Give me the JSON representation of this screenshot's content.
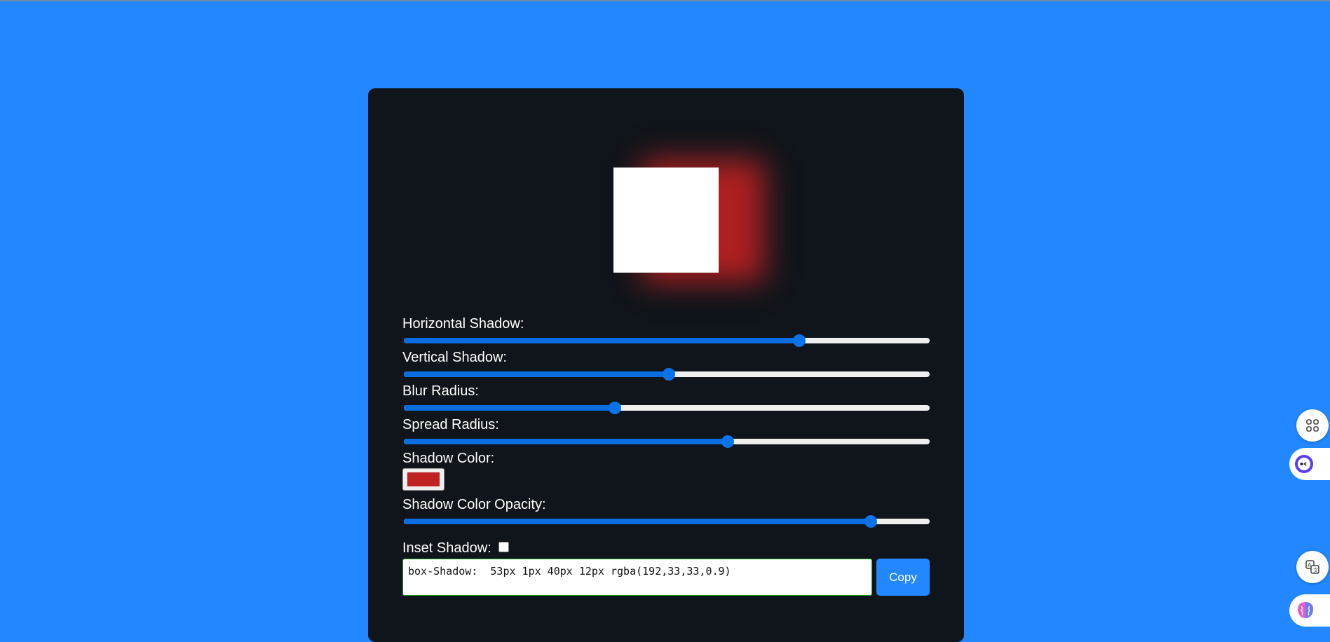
{
  "preview": {
    "box_color": "#ffffff",
    "shadow_color": "#c02121"
  },
  "controls": {
    "horizontal": {
      "label": "Horizontal Shadow:",
      "value_fraction": 0.76
    },
    "vertical": {
      "label": "Vertical Shadow:",
      "value_fraction": 0.505
    },
    "blur": {
      "label": "Blur Radius:",
      "value_fraction": 0.4
    },
    "spread": {
      "label": "Spread Radius:",
      "value_fraction": 0.62
    },
    "color": {
      "label": "Shadow Color:",
      "value": "#c02121"
    },
    "opacity": {
      "label": "Shadow Color Opacity:",
      "value_fraction": 0.9
    },
    "inset": {
      "label": "Inset Shadow:",
      "checked": false
    }
  },
  "output": {
    "code_text": "box-Shadow:  53px 1px 40px 12px rgba(192,33,33,0.9)",
    "copy_label": "Copy"
  },
  "colors": {
    "background": "#2388ff",
    "card": "#0f151b",
    "accent": "#0a73ea"
  },
  "side_icons": [
    "apps-grid-icon",
    "chat-assistant-icon",
    "translate-icon",
    "brain-ai-icon"
  ]
}
